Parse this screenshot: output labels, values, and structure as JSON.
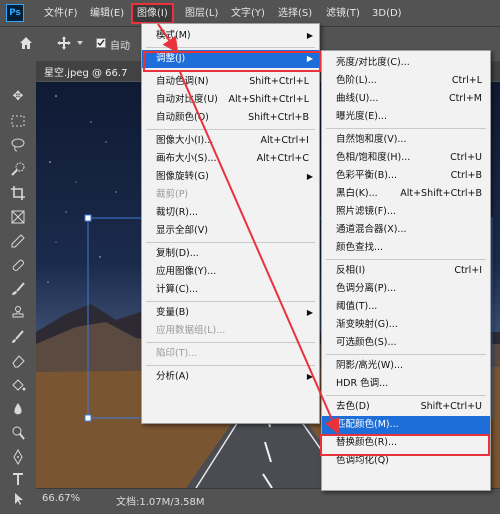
{
  "app": {
    "logo": "Ps"
  },
  "menubar": [
    "文件(F)",
    "编辑(E)",
    "图像(I)",
    "图层(L)",
    "文字(Y)",
    "选择(S)",
    "滤镜(T)",
    "3D(D)"
  ],
  "options": {
    "auto_label": "自动"
  },
  "document": {
    "tab": "星空.jpeg @ 66.7"
  },
  "statusbar": {
    "zoom": "66.67%",
    "doc": "文档:1.07M/3.58M"
  },
  "image_menu": [
    {
      "label": "模式(M)",
      "shortcut": "",
      "submenu": true
    },
    {
      "separator": true
    },
    {
      "label": "调整(J)",
      "shortcut": "",
      "submenu": true,
      "highlight": true
    },
    {
      "separator": true
    },
    {
      "label": "自动色调(N)",
      "shortcut": "Shift+Ctrl+L"
    },
    {
      "label": "自动对比度(U)",
      "shortcut": "Alt+Shift+Ctrl+L"
    },
    {
      "label": "自动颜色(O)",
      "shortcut": "Shift+Ctrl+B"
    },
    {
      "separator": true
    },
    {
      "label": "图像大小(I)...",
      "shortcut": "Alt+Ctrl+I"
    },
    {
      "label": "画布大小(S)...",
      "shortcut": "Alt+Ctrl+C"
    },
    {
      "label": "图像旋转(G)",
      "shortcut": "",
      "submenu": true
    },
    {
      "label": "裁剪(P)",
      "shortcut": "",
      "disabled": true
    },
    {
      "label": "裁切(R)...",
      "shortcut": ""
    },
    {
      "label": "显示全部(V)",
      "shortcut": ""
    },
    {
      "separator": true
    },
    {
      "label": "复制(D)...",
      "shortcut": ""
    },
    {
      "label": "应用图像(Y)...",
      "shortcut": ""
    },
    {
      "label": "计算(C)...",
      "shortcut": ""
    },
    {
      "separator": true
    },
    {
      "label": "变量(B)",
      "shortcut": "",
      "submenu": true
    },
    {
      "label": "应用数据组(L)...",
      "shortcut": "",
      "disabled": true
    },
    {
      "separator": true
    },
    {
      "label": "陷印(T)...",
      "shortcut": "",
      "disabled": true
    },
    {
      "separator": true
    },
    {
      "label": "分析(A)",
      "shortcut": "",
      "submenu": true
    }
  ],
  "adjust_menu": [
    {
      "label": "亮度/对比度(C)...",
      "shortcut": ""
    },
    {
      "label": "色阶(L)...",
      "shortcut": "Ctrl+L"
    },
    {
      "label": "曲线(U)...",
      "shortcut": "Ctrl+M"
    },
    {
      "label": "曝光度(E)...",
      "shortcut": ""
    },
    {
      "separator": true
    },
    {
      "label": "自然饱和度(V)...",
      "shortcut": ""
    },
    {
      "label": "色相/饱和度(H)...",
      "shortcut": "Ctrl+U"
    },
    {
      "label": "色彩平衡(B)...",
      "shortcut": "Ctrl+B"
    },
    {
      "label": "黑白(K)...",
      "shortcut": "Alt+Shift+Ctrl+B"
    },
    {
      "label": "照片滤镜(F)...",
      "shortcut": ""
    },
    {
      "label": "通道混合器(X)...",
      "shortcut": ""
    },
    {
      "label": "颜色查找...",
      "shortcut": ""
    },
    {
      "separator": true
    },
    {
      "label": "反相(I)",
      "shortcut": "Ctrl+I"
    },
    {
      "label": "色调分离(P)...",
      "shortcut": ""
    },
    {
      "label": "阈值(T)...",
      "shortcut": ""
    },
    {
      "label": "渐变映射(G)...",
      "shortcut": ""
    },
    {
      "label": "可选颜色(S)...",
      "shortcut": ""
    },
    {
      "separator": true
    },
    {
      "label": "阴影/高光(W)...",
      "shortcut": ""
    },
    {
      "label": "HDR 色调...",
      "shortcut": ""
    },
    {
      "separator": true
    },
    {
      "label": "去色(D)",
      "shortcut": "Shift+Ctrl+U"
    },
    {
      "label": "匹配颜色(M)...",
      "shortcut": "",
      "highlight": true
    },
    {
      "label": "替换颜色(R)...",
      "shortcut": ""
    },
    {
      "label": "色调均化(Q)",
      "shortcut": ""
    }
  ],
  "colors": {
    "highlight": "#1d6ed8",
    "annotation": "#e8323c",
    "menu_bg": "#f2f2f2",
    "ui_bg": "#535353"
  }
}
